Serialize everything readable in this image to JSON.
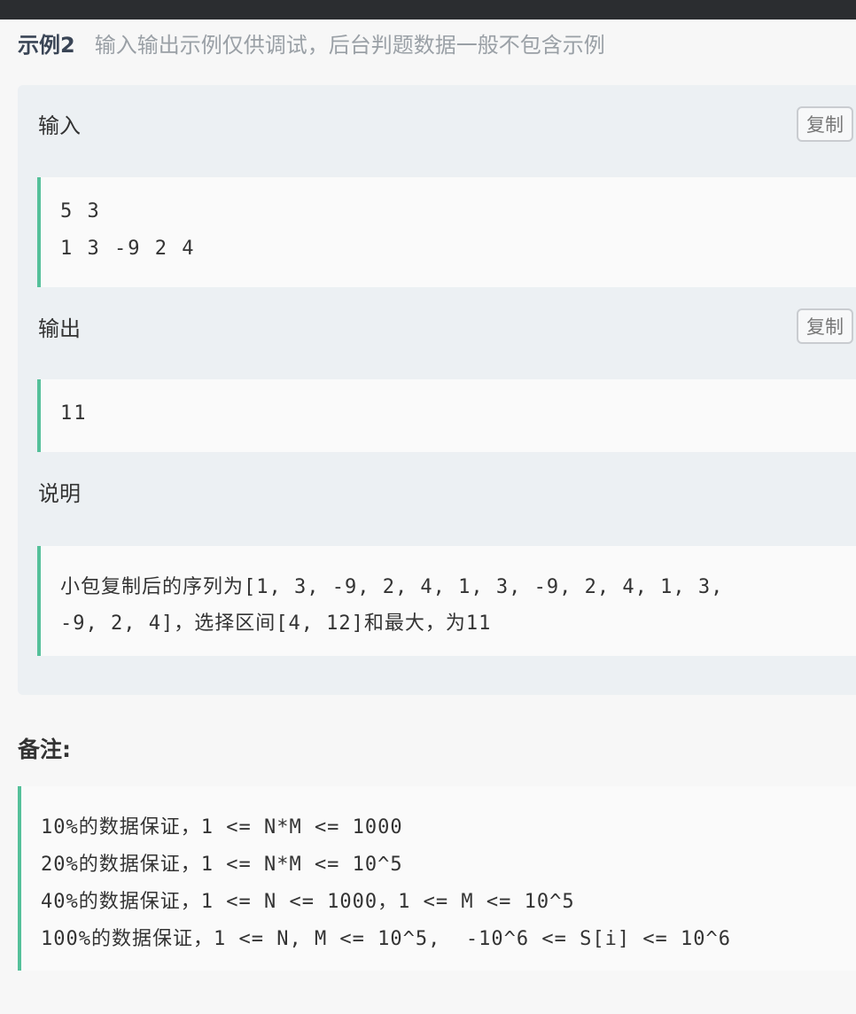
{
  "example": {
    "title": "示例2",
    "note": "输入输出示例仅供调试，后台判题数据一般不包含示例",
    "input": {
      "label": "输入",
      "copy_label": "复制",
      "lines": [
        "5 3",
        "1 3 -9 2 4"
      ]
    },
    "output": {
      "label": "输出",
      "copy_label": "复制",
      "lines": [
        "11"
      ]
    },
    "explanation": {
      "label": "说明",
      "lines": [
        "小包复制后的序列为[1, 3, -9, 2, 4, 1, 3, -9, 2, 4, 1, 3,",
        "-9, 2, 4]，选择区间[4, 12]和最大，为11"
      ]
    }
  },
  "remarks": {
    "title": "备注:",
    "lines": [
      "10%的数据保证，1 <= N*M <= 1000",
      "20%的数据保证，1 <= N*M <= 10^5",
      "40%的数据保证，1 <= N <= 1000，1 <= M <= 10^5",
      "100%的数据保证，1 <= N, M <= 10^5,  -10^6 <= S[i] <= 10^6"
    ]
  }
}
